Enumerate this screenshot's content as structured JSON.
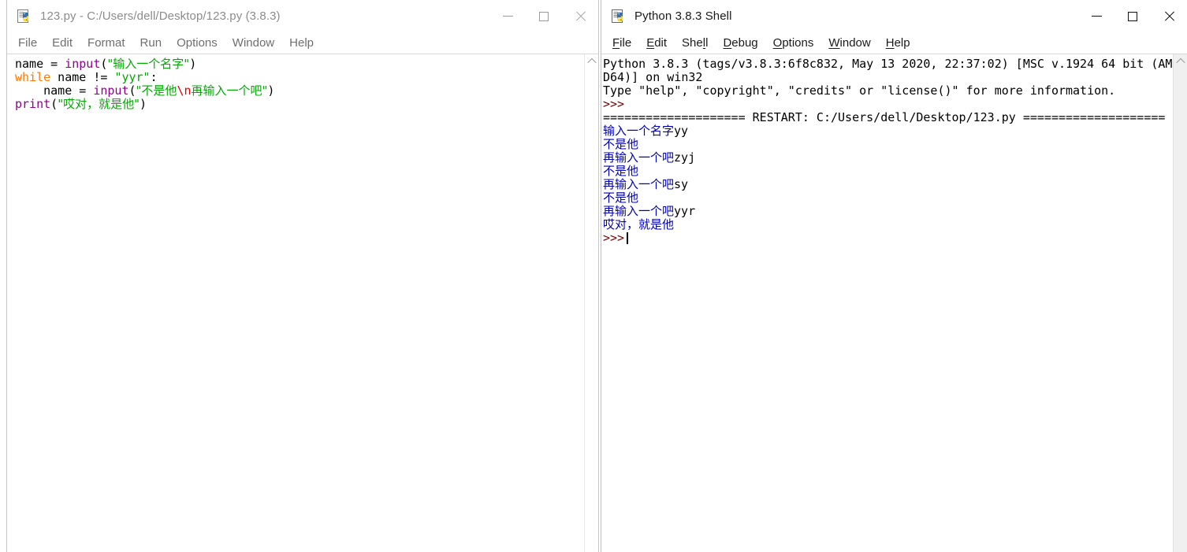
{
  "editor_window": {
    "icon": "python-idle-icon",
    "title": "123.py - C:/Users/dell/Desktop/123.py (3.8.3)",
    "active": false,
    "caption": {
      "minimize": "minimize-button",
      "maximize": "maximize-button",
      "close": "close-button"
    },
    "menu": [
      {
        "label": "File"
      },
      {
        "label": "Edit"
      },
      {
        "label": "Format"
      },
      {
        "label": "Run"
      },
      {
        "label": "Options"
      },
      {
        "label": "Window"
      },
      {
        "label": "Help"
      }
    ],
    "code": [
      [
        {
          "text": "name = ",
          "cls": "tok-plain"
        },
        {
          "text": "input",
          "cls": "tok-builtin"
        },
        {
          "text": "(",
          "cls": "tok-plain"
        },
        {
          "text": "\"输入一个名字\"",
          "cls": "tok-str"
        },
        {
          "text": ")",
          "cls": "tok-plain"
        }
      ],
      [
        {
          "text": "while",
          "cls": "tok-kw"
        },
        {
          "text": " name != ",
          "cls": "tok-plain"
        },
        {
          "text": "\"yyr\"",
          "cls": "tok-str"
        },
        {
          "text": ":",
          "cls": "tok-plain"
        }
      ],
      [
        {
          "text": "    name = ",
          "cls": "tok-plain"
        },
        {
          "text": "input",
          "cls": "tok-builtin"
        },
        {
          "text": "(",
          "cls": "tok-plain"
        },
        {
          "text": "\"不是他",
          "cls": "tok-str"
        },
        {
          "text": "\\n",
          "cls": "tok-esc"
        },
        {
          "text": "再输入一个吧\"",
          "cls": "tok-str"
        },
        {
          "text": ")",
          "cls": "tok-plain"
        }
      ],
      [
        {
          "text": "print",
          "cls": "tok-builtin"
        },
        {
          "text": "(",
          "cls": "tok-plain"
        },
        {
          "text": "\"哎对，就是他\"",
          "cls": "tok-str"
        },
        {
          "text": ")",
          "cls": "tok-plain"
        }
      ]
    ]
  },
  "shell_window": {
    "icon": "python-idle-icon",
    "title": "Python 3.8.3 Shell",
    "active": true,
    "caption": {
      "minimize": "minimize-button",
      "maximize": "maximize-button",
      "close": "close-button"
    },
    "menu": [
      {
        "pre": "",
        "acc": "F",
        "post": "ile"
      },
      {
        "pre": "",
        "acc": "E",
        "post": "dit"
      },
      {
        "pre": "She",
        "acc": "l",
        "post": "l"
      },
      {
        "pre": "",
        "acc": "D",
        "post": "ebug"
      },
      {
        "pre": "",
        "acc": "O",
        "post": "ptions"
      },
      {
        "pre": "",
        "acc": "W",
        "post": "indow"
      },
      {
        "pre": "",
        "acc": "H",
        "post": "elp"
      }
    ],
    "output": [
      [
        {
          "text": "Python 3.8.3 (tags/v3.8.3:6f8c832, May 13 2020, 22:37:02) [MSC v.1924 64 bit (AM",
          "cls": "tok-plain"
        }
      ],
      [
        {
          "text": "D64)] on win32",
          "cls": "tok-plain"
        }
      ],
      [
        {
          "text": "Type \"help\", \"copyright\", \"credits\" or \"license()\" for more information.",
          "cls": "tok-plain"
        }
      ],
      [
        {
          "text": ">>>",
          "cls": "tok-prompt"
        }
      ],
      [
        {
          "text": "==================== RESTART: C:/Users/dell/Desktop/123.py ====================",
          "cls": "tok-plain"
        }
      ],
      [
        {
          "text": "输入一个名字",
          "cls": "tok-out"
        },
        {
          "text": "yy",
          "cls": "tok-stdin"
        }
      ],
      [
        {
          "text": "不是他",
          "cls": "tok-out"
        }
      ],
      [
        {
          "text": "再输入一个吧",
          "cls": "tok-out"
        },
        {
          "text": "zyj",
          "cls": "tok-stdin"
        }
      ],
      [
        {
          "text": "不是他",
          "cls": "tok-out"
        }
      ],
      [
        {
          "text": "再输入一个吧",
          "cls": "tok-out"
        },
        {
          "text": "sy",
          "cls": "tok-stdin"
        }
      ],
      [
        {
          "text": "不是他",
          "cls": "tok-out"
        }
      ],
      [
        {
          "text": "再输入一个吧",
          "cls": "tok-out"
        },
        {
          "text": "yyr",
          "cls": "tok-stdin"
        }
      ],
      [
        {
          "text": "哎对，就是他",
          "cls": "tok-out"
        }
      ],
      [
        {
          "text": ">>>",
          "cls": "tok-prompt",
          "caret": true
        }
      ]
    ]
  },
  "colors": {
    "keyword": "#ff7700",
    "builtin": "#900090",
    "string": "#00aa00",
    "escape": "#dd0000",
    "prompt": "#770000",
    "stdout": "#0000bb",
    "background": "#ffffff"
  }
}
